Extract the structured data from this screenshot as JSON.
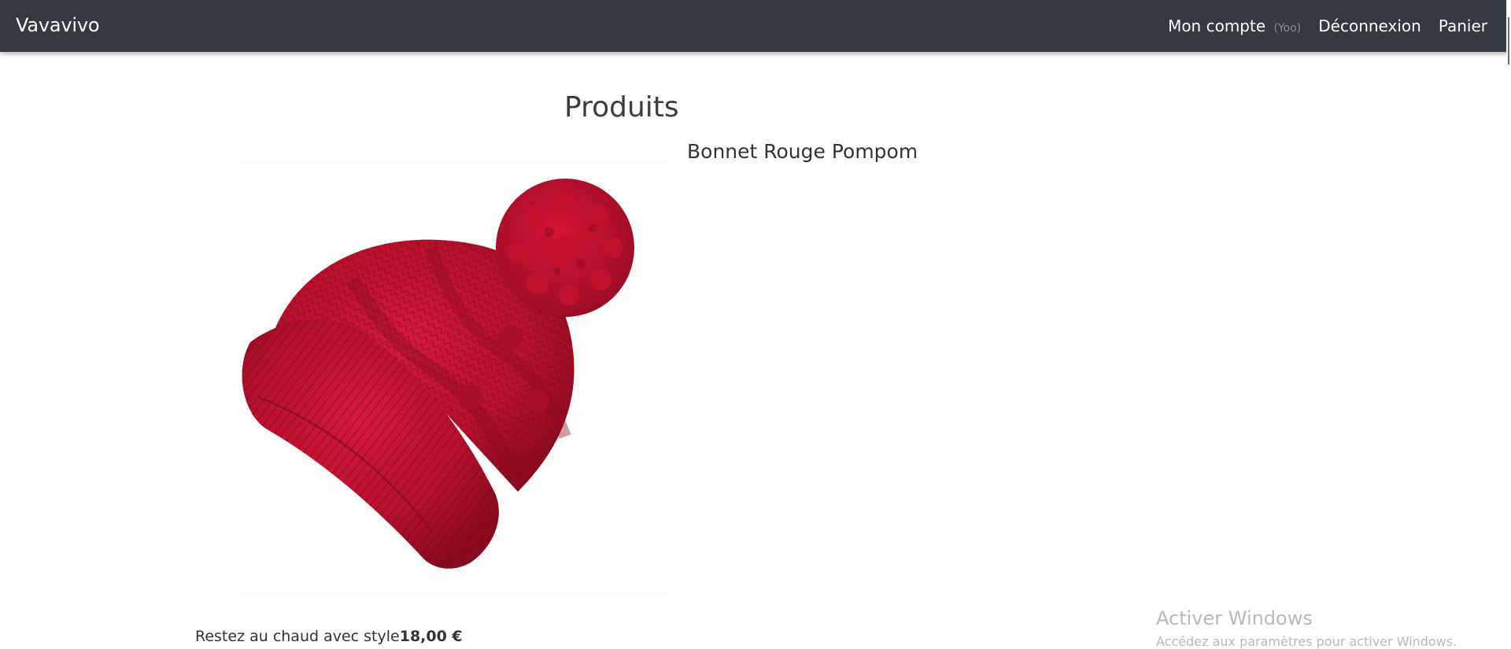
{
  "navbar": {
    "brand": "Vavavivo",
    "account_label": "Mon compte",
    "account_user": "(Yoo)",
    "logout_label": "Déconnexion",
    "cart_label": "Panier",
    "background_color": "#343a40"
  },
  "main": {
    "page_title": "Produits",
    "product": {
      "name": "Bonnet Rouge Pompom",
      "image_icon": "red-knitted-beanie-image",
      "description": "Restez au chaud avec style",
      "price": "18,00 €"
    }
  },
  "windows_watermark": {
    "title": "Activer Windows",
    "subtitle": "Accédez aux paramètres pour activer Windows."
  }
}
